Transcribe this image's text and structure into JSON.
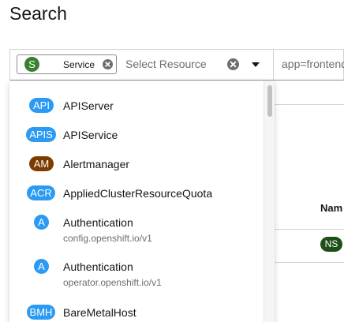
{
  "page": {
    "title": "Search"
  },
  "filter": {
    "chip": {
      "badge": "S",
      "label": "Service",
      "badge_color": "#38812f"
    },
    "resource_placeholder": "Select Resource",
    "label_filter_value": "app=frontend"
  },
  "background": {
    "column_header": "Nam",
    "ns_badge": "NS"
  },
  "menu": {
    "items": [
      {
        "badge": "API",
        "name": "APIServer",
        "badge_color": "#2b9af3"
      },
      {
        "badge": "APIS",
        "name": "APIService",
        "badge_color": "#2b9af3"
      },
      {
        "badge": "AM",
        "name": "Alertmanager",
        "badge_color": "#7d3b00"
      },
      {
        "badge": "ACR",
        "name": "AppliedClusterResourceQuota",
        "badge_color": "#2b9af3"
      },
      {
        "badge": "A",
        "name": "Authentication",
        "group": "config.openshift.io/v1",
        "badge_color": "#2b9af3"
      },
      {
        "badge": "A",
        "name": "Authentication",
        "group": "operator.openshift.io/v1",
        "badge_color": "#2b9af3"
      },
      {
        "badge": "BMH",
        "name": "BareMetalHost",
        "badge_color": "#2b9af3"
      }
    ]
  }
}
